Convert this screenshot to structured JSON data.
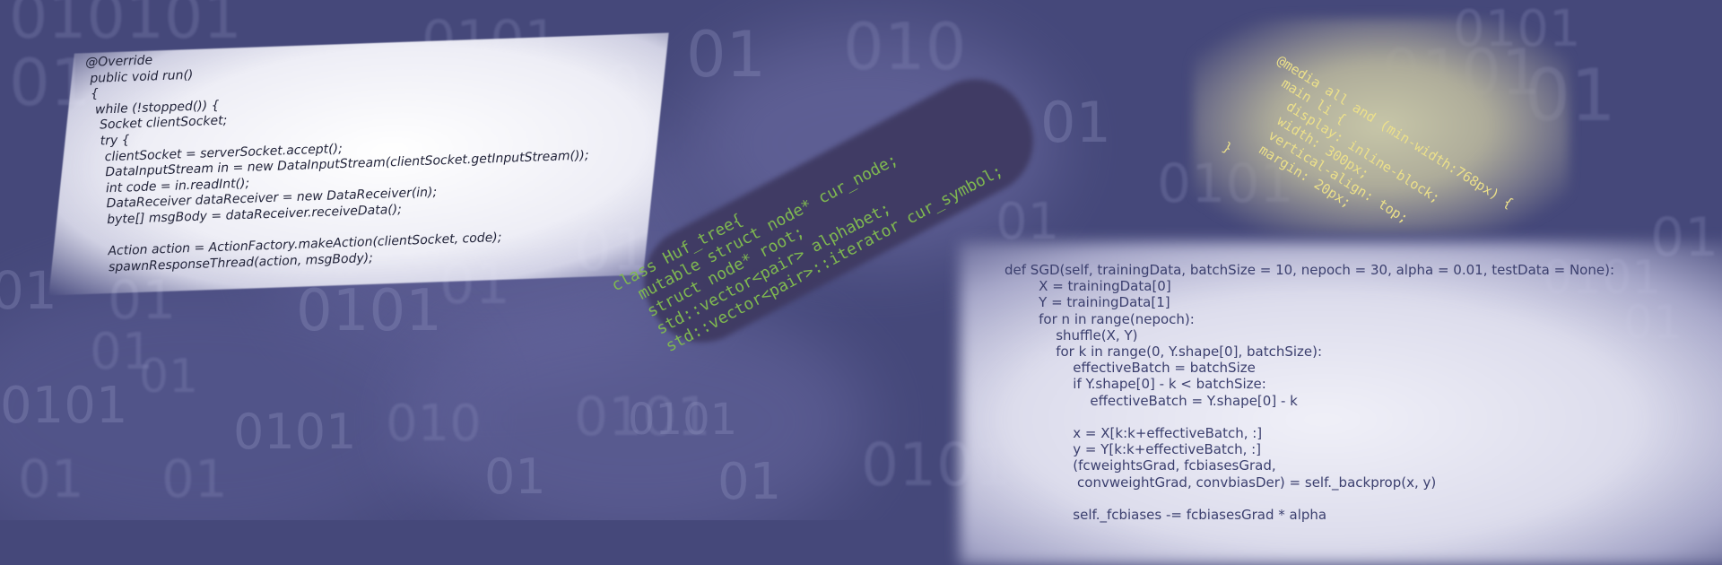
{
  "background": {
    "colors": {
      "base": "#45487a",
      "digit": "#8d90bd"
    },
    "binary_digits": [
      "010101",
      "01",
      "0101",
      "01",
      "0",
      "01",
      "010",
      "01",
      "0101",
      "01",
      "0101",
      "01",
      "0101",
      "01",
      "01",
      "0",
      "01",
      "01",
      "0101",
      "01",
      "01",
      "0101",
      "01",
      "0101",
      "010",
      "01",
      "0101",
      "01",
      "0101",
      "01",
      "01",
      "0101",
      "0101",
      "01",
      "010",
      "0101",
      "01"
    ]
  },
  "snippets": {
    "java": {
      "code": "@Override\n public void run()\n {\n  while (!stopped()) {\n   Socket clientSocket;\n   try {\n    clientSocket = serverSocket.accept();\n    DataInputStream in = new DataInputStream(clientSocket.getInputStream());\n    int code = in.readInt();\n    DataReceiver dataReceiver = new DataReceiver(in);\n    byte[] msgBody = dataReceiver.receiveData();\n\n    Action action = ActionFactory.makeAction(clientSocket, code);\n    spawnResponseThread(action, msgBody);",
      "color": "#22243a"
    },
    "huffman": {
      "code": "class Huf_tree{\n  mutable struct node* cur_node;\n  struct node* root;\n  std::vector<pair> alphabet;\n  std::vector<pair>::iterator cur_symbol;",
      "color": "#7fb850"
    },
    "css": {
      "code": "@media all and (min-width:768px) {\n  main li {\n    display: inline-block;\n    width: 300px;\n    vertical-align: top;\n    margin: 20px;\n}",
      "color": "#ece08a"
    },
    "python": {
      "code": "def SGD(self, trainingData, batchSize = 10, nepoch = 30, alpha = 0.01, testData = None):\n        X = trainingData[0]\n        Y = trainingData[1]\n        for n in range(nepoch):\n            shuffle(X, Y)\n            for k in range(0, Y.shape[0], batchSize):\n                effectiveBatch = batchSize\n                if Y.shape[0] - k < batchSize:\n                    effectiveBatch = Y.shape[0] - k\n\n                x = X[k:k+effectiveBatch, :]\n                y = Y[k:k+effectiveBatch, :]\n                (fcweightsGrad, fcbiasesGrad,\n                 convweightGrad, convbiasDer) = self._backprop(x, y)\n\n                self._fcbiases -= fcbiasesGrad * alpha",
      "color": "#3b3f6e"
    }
  }
}
